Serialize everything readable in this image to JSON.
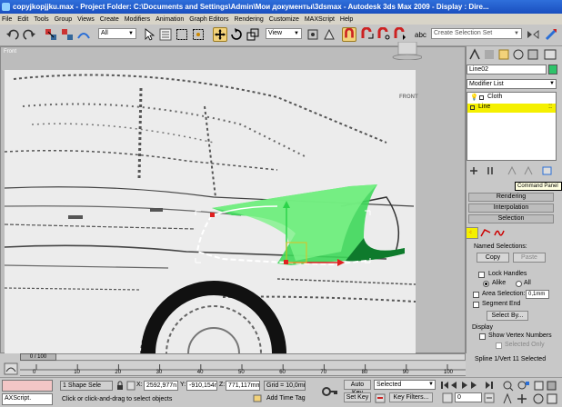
{
  "window": {
    "title": "copyjkopjjku.max   - Project Folder: C:\\Documents and Settings\\Admin\\Мои документы\\3dsmax   - Autodesk 3ds Max  2009   - Display : Dire..."
  },
  "menu": [
    "File",
    "Edit",
    "Tools",
    "Group",
    "Views",
    "Create",
    "Modifiers",
    "Animation",
    "Graph Editors",
    "Rendering",
    "Customize",
    "MAXScript",
    "Help"
  ],
  "toolbar": {
    "selection_filter": "All",
    "reference_coord": "View",
    "named_selection_placeholder": "Create Selection Set"
  },
  "viewport": {
    "label": "Front",
    "nav_cube_label": "FRONT"
  },
  "command_panel": {
    "object_name": "Line02",
    "object_color": "#2ec36a",
    "modifier_list": "Modifier List",
    "stack": [
      {
        "label": "Cloth",
        "selected": false
      },
      {
        "label": "Line",
        "selected": true
      }
    ],
    "tooltip": "Command Panel",
    "rollouts": {
      "rendering": "Rendering",
      "interpolation": "Interpolation",
      "selection": "Selection"
    },
    "named_selections": {
      "title": "Named Selections:",
      "copy": "Copy",
      "paste": "Paste"
    },
    "options": {
      "lock_handles": "Lock Handles",
      "alike": "Alike",
      "all": "All",
      "area_selection": "Area Selection:",
      "area_selection_value": "0,1mm",
      "segment_end": "Segment End",
      "select_by": "Select By..."
    },
    "display": {
      "title": "Display",
      "show_vertex_numbers": "Show Vertex Numbers",
      "selected_only": "Selected Only"
    },
    "status": "Spline 1/Vert 11 Selected"
  },
  "timeline": {
    "position": "0 / 100",
    "position_fraction": 0,
    "ticks": [
      "0",
      "10",
      "20",
      "30",
      "40",
      "50",
      "60",
      "70",
      "80",
      "90",
      "100"
    ]
  },
  "status_bar": {
    "maxscript": "AXScript.",
    "selection_info": "1 Shape Sele",
    "prompt": "Click or click-and-drag to select objects",
    "x_label": "X:",
    "x_value": "2592,977n",
    "y_label": "Y:",
    "y_value": "-910,154m",
    "z_label": "Z:",
    "z_value": "771,117mm",
    "grid": "Grid = 10,0mm",
    "add_time_tag": "Add Time Tag",
    "auto_key": "Auto Key",
    "set_key": "Set Key",
    "key_mode": "Selected",
    "key_filters": "Key Filters...",
    "frame": "0"
  }
}
